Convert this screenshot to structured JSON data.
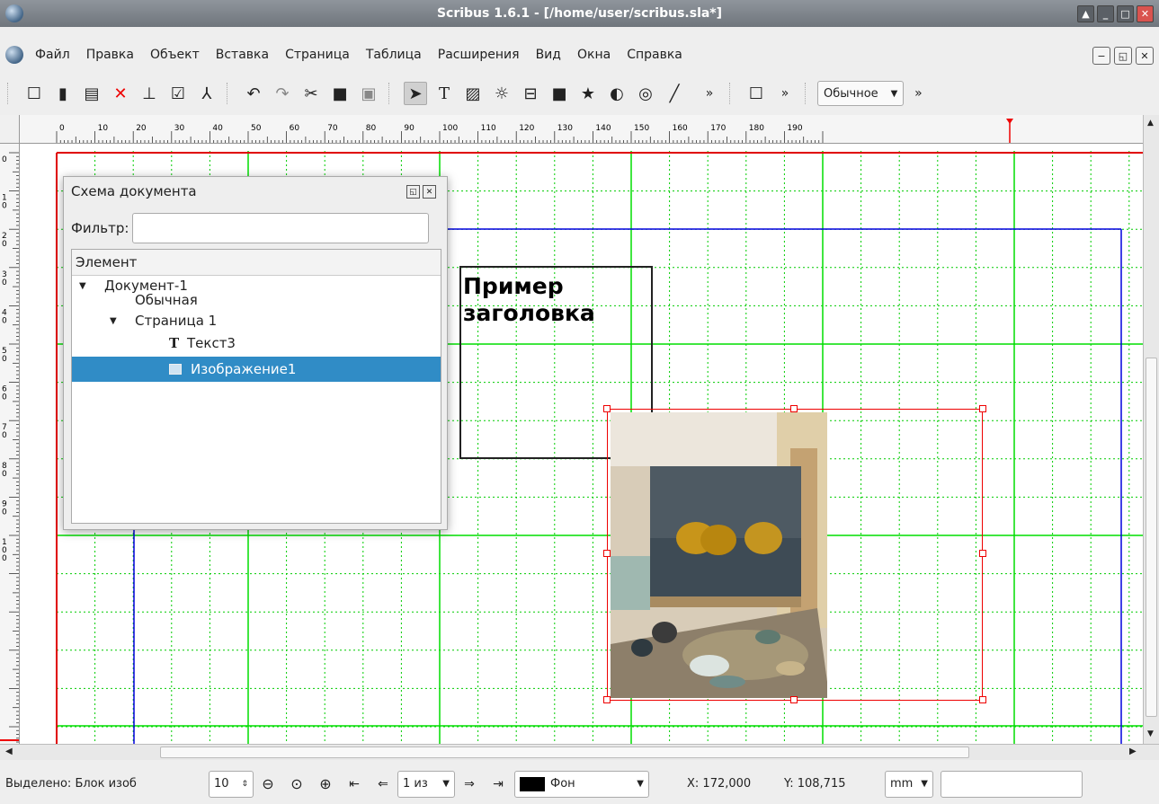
{
  "window": {
    "title": "Scribus 1.6.1 - [/home/user/scribus.sla*]"
  },
  "menu": [
    {
      "label": "Файл"
    },
    {
      "label": "Правка"
    },
    {
      "label": "Объект"
    },
    {
      "label": "Вставка"
    },
    {
      "label": "Страница"
    },
    {
      "label": "Таблица"
    },
    {
      "label": "Расширения"
    },
    {
      "label": "Вид"
    },
    {
      "label": "Окна"
    },
    {
      "label": "Справка"
    }
  ],
  "toolbar": {
    "style_combo": "Обычное",
    "more": "»"
  },
  "ruler": {
    "h_labels": [
      "0",
      "10",
      "20",
      "30",
      "40",
      "50",
      "60",
      "70",
      "80",
      "90",
      "100",
      "110",
      "120",
      "130",
      "140",
      "150",
      "160",
      "170",
      "180",
      "190"
    ],
    "v_labels": [
      "0",
      "10",
      "20",
      "30",
      "40",
      "50",
      "60",
      "70",
      "80",
      "90",
      "100"
    ]
  },
  "outline_panel": {
    "title": "Схема документа",
    "filter_label": "Фильтр:",
    "filter_value": "",
    "column_header": "Элемент",
    "items": [
      {
        "label": "Документ-1"
      },
      {
        "label": "Обычная"
      },
      {
        "label": "Страница 1"
      },
      {
        "label": "Текст3"
      },
      {
        "label": "Изображение1"
      }
    ]
  },
  "page": {
    "heading_text": "Пример\nзаголовка"
  },
  "status": {
    "selection": "Выделено: Блок изоб",
    "zoom": "10",
    "page_of": "1 из",
    "layer": "Фон",
    "x": "X: 172,000",
    "y": "Y: 108,715",
    "unit": "mm"
  },
  "colors": {
    "grid_major": "#00dd00",
    "grid_minor": "#00cc00",
    "margin": "#0000dd",
    "page_border": "#e00000",
    "selection": "#308cc6"
  }
}
